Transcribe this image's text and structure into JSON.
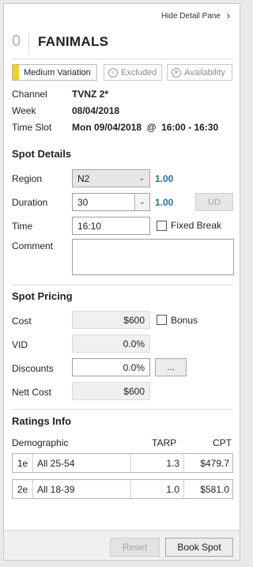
{
  "header": {
    "hide_pane_label": "Hide Detail Pane",
    "chevron_icon": "chevron-right-icon",
    "count": "0",
    "title": "FANIMALS"
  },
  "tags": {
    "variation": "Medium Variation",
    "variation_color": "#f2d318",
    "excluded": "Excluded",
    "excluded_icon": "info-circle-icon",
    "availability": "Availability",
    "availability_icon": "x-circle-icon"
  },
  "info": {
    "channel_label": "Channel",
    "channel_value": "TVNZ 2*",
    "week_label": "Week",
    "week_value": "08/04/2018",
    "timeslot_label": "Time Slot",
    "timeslot_value": "Mon 09/04/2018  @  16:00 - 16:30"
  },
  "spot_details": {
    "heading": "Spot Details",
    "region_label": "Region",
    "region_value": "N2",
    "region_factor": "1.00",
    "duration_label": "Duration",
    "duration_value": "30",
    "duration_factor": "1.00",
    "ud_label": "UD",
    "time_label": "Time",
    "time_value": "16:10",
    "fixed_break_label": "Fixed Break",
    "comment_label": "Comment",
    "comment_value": ""
  },
  "spot_pricing": {
    "heading": "Spot Pricing",
    "cost_label": "Cost",
    "cost_value": "$600",
    "bonus_label": "Bonus",
    "vid_label": "VID",
    "vid_value": "0.0%",
    "discounts_label": "Discounts",
    "discounts_value": "0.0%",
    "ellipsis_label": "...",
    "nett_cost_label": "Nett Cost",
    "nett_cost_value": "$600"
  },
  "ratings": {
    "heading": "Ratings Info",
    "columns": [
      "Demographic",
      "TARP",
      "CPT"
    ],
    "rows": [
      {
        "code": "1e",
        "demo": "All 25-54",
        "tarp": "1.3",
        "cpt": "$479.7"
      },
      {
        "code": "2e",
        "demo": "All 18-39",
        "tarp": "1.0",
        "cpt": "$581.0"
      }
    ]
  },
  "footer": {
    "reset_label": "Reset",
    "book_label": "Book Spot"
  }
}
